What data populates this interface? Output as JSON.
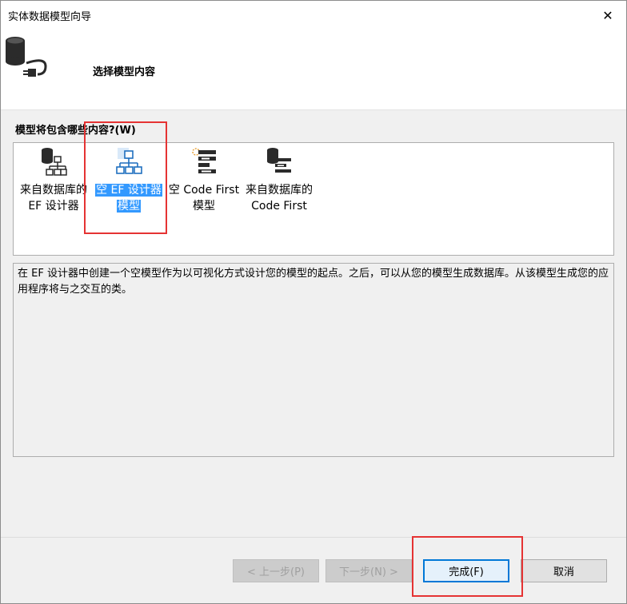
{
  "window": {
    "title": "实体数据模型向导",
    "close_glyph": "✕"
  },
  "header": {
    "title": "选择模型内容",
    "icon": "database-plug-icon"
  },
  "question": "模型将包含哪些内容?(W)",
  "items": [
    {
      "line1": "来自数据库的",
      "line2": "EF 设计器",
      "icon": "database-hierarchy-icon",
      "selected": false
    },
    {
      "line1": "空 EF 设计器",
      "line2": "模型",
      "icon": "hierarchy-icon",
      "selected": true
    },
    {
      "line1": "空 Code First",
      "line2": "模型",
      "icon": "code-first-icon",
      "selected": false
    },
    {
      "line1": "来自数据库的",
      "line2": "Code First",
      "icon": "database-code-first-icon",
      "selected": false
    }
  ],
  "description": "在 EF 设计器中创建一个空模型作为以可视化方式设计您的模型的起点。之后，可以从您的模型生成数据库。从该模型生成您的应用程序将与之交互的类。",
  "buttons": {
    "prev": "< 上一步(P)",
    "next": "下一步(N) >",
    "finish": "完成(F)",
    "cancel": "取消"
  },
  "colors": {
    "selection": "#3399ff",
    "highlight_box": "#e53333",
    "accent": "#0078d7"
  }
}
